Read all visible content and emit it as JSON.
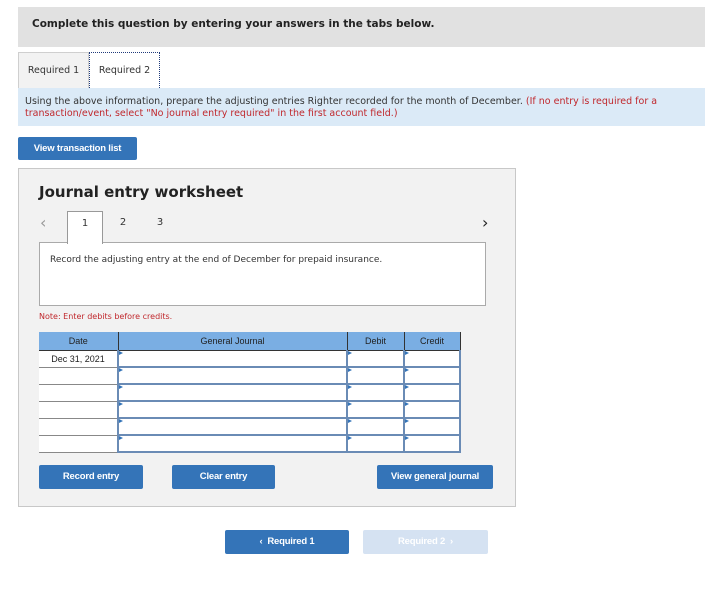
{
  "instruction": "Complete this question by entering your answers in the tabs below.",
  "tabs": [
    {
      "label": "Required 1",
      "active": false
    },
    {
      "label": "Required 2",
      "active": true
    }
  ],
  "prompt": {
    "text": "Using the above information, prepare the adjusting entries Righter recorded for the month of December.",
    "note": "(If no entry is required for a transaction/event, select \"No journal entry required\" in the first account field.)"
  },
  "view_transaction_list": "View transaction list",
  "worksheet": {
    "title": "Journal entry worksheet",
    "prev_icon": "chevron-left-icon",
    "next_icon": "chevron-right-icon",
    "entry_tabs": [
      "1",
      "2",
      "3"
    ],
    "active_entry": "1",
    "description": "Record the adjusting entry at the end of December for prepaid insurance.",
    "note": "Note: Enter debits before credits.",
    "table": {
      "headers": [
        "Date",
        "General Journal",
        "Debit",
        "Credit"
      ],
      "rows": [
        {
          "date": "Dec 31, 2021",
          "account": "",
          "debit": "",
          "credit": ""
        },
        {
          "date": "",
          "account": "",
          "debit": "",
          "credit": ""
        },
        {
          "date": "",
          "account": "",
          "debit": "",
          "credit": ""
        },
        {
          "date": "",
          "account": "",
          "debit": "",
          "credit": ""
        },
        {
          "date": "",
          "account": "",
          "debit": "",
          "credit": ""
        },
        {
          "date": "",
          "account": "",
          "debit": "",
          "credit": ""
        }
      ]
    },
    "buttons": {
      "record": "Record entry",
      "clear": "Clear entry",
      "view_general_journal": "View general journal"
    }
  },
  "footer_nav": {
    "prev_label": "Required 1",
    "next_label": "Required 2",
    "next_disabled": true
  }
}
